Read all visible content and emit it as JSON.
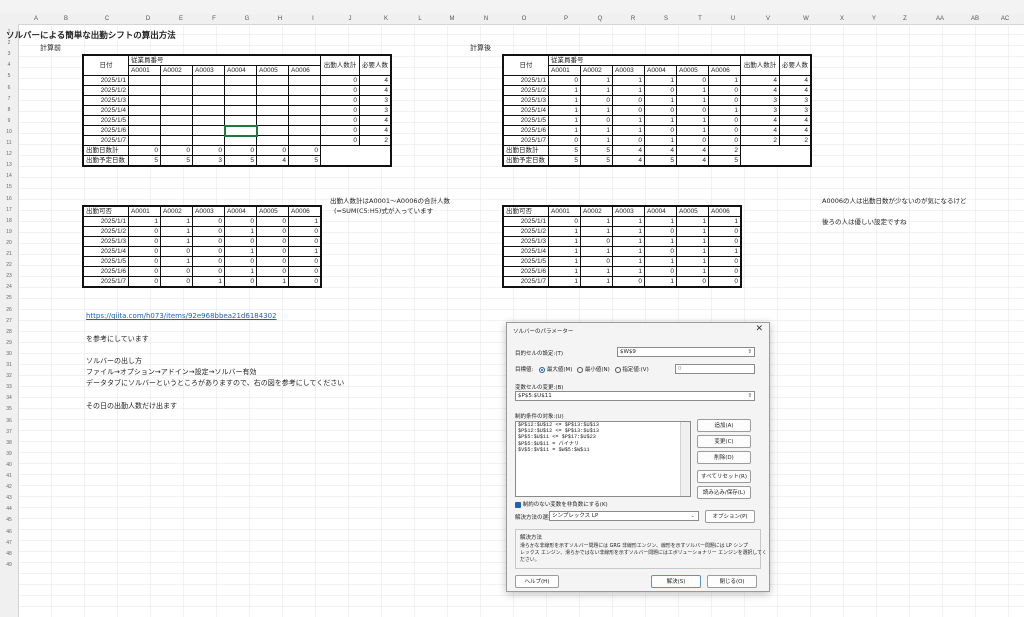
{
  "columns": [
    "A",
    "B",
    "C",
    "D",
    "E",
    "F",
    "G",
    "H",
    "I",
    "J",
    "K",
    "L",
    "M",
    "N",
    "O",
    "P",
    "Q",
    "R",
    "S",
    "T",
    "U",
    "V",
    "W",
    "X",
    "Y",
    "Z",
    "AA",
    "AB",
    "AC"
  ],
  "rows": [
    "1",
    "2",
    "3",
    "4",
    "5",
    "6",
    "7",
    "8",
    "9",
    "10",
    "11",
    "12",
    "13",
    "14",
    "15",
    "16",
    "17",
    "18",
    "19",
    "20",
    "21",
    "22",
    "23",
    "24",
    "25",
    "26",
    "27",
    "28",
    "29",
    "30",
    "31",
    "32",
    "33",
    "34",
    "35",
    "36",
    "37",
    "38",
    "39",
    "40",
    "41",
    "42",
    "43",
    "44",
    "45",
    "46",
    "47",
    "48",
    "49"
  ],
  "sheet": {
    "title": "ソルバーによる簡単な出勤シフトの算出方法",
    "before_label": "計算前",
    "after_label": "計算後",
    "sum_note_1": "出勤人数計はA0001～A0006の合計人数",
    "sum_note_2": "(=SUM(C5:H5)式が入っています",
    "comment_1": "A0006の人は出勤日数が少ないのが気になるけど",
    "comment_2": "後ろの人は優しい設定ですね",
    "link": "https://qiita.com/h073/items/92e968bbea21d6184302",
    "ref_note": "を参考にしています",
    "howto_title": "ソルバーの出し方",
    "howto_1": "ファイル→オプション→アドイン→設定→ソルバー有効",
    "howto_2": "データタブにソルバーというところがありますので、右の図を参考にしてください",
    "closing": "その日の出勤人数だけ出ます"
  },
  "shift_headers": {
    "date": "日付",
    "staff_no": "従業員番号",
    "ids": [
      "A0001",
      "A0002",
      "A0003",
      "A0004",
      "A0005",
      "A0006"
    ],
    "total": "出勤人数計",
    "required": "必要人数"
  },
  "dates": [
    "2025/1/1",
    "2025/1/2",
    "2025/1/3",
    "2025/1/4",
    "2025/1/5",
    "2025/1/6",
    "2025/1/7"
  ],
  "before": {
    "totals": [
      "0",
      "0",
      "0",
      "0",
      "0",
      "0",
      "0"
    ],
    "required": [
      "4",
      "4",
      "3",
      "3",
      "4",
      "4",
      "2"
    ],
    "days_label": "出勤日数計",
    "days": [
      "0",
      "0",
      "0",
      "0",
      "0",
      "0"
    ],
    "plan_label": "出勤予定日数",
    "plan": [
      "5",
      "5",
      "3",
      "5",
      "4",
      "5"
    ]
  },
  "after": {
    "matrix": [
      [
        "0",
        "1",
        "1",
        "1",
        "0",
        "1"
      ],
      [
        "1",
        "1",
        "1",
        "0",
        "1",
        "0"
      ],
      [
        "1",
        "0",
        "0",
        "1",
        "1",
        "0"
      ],
      [
        "1",
        "1",
        "0",
        "0",
        "0",
        "1"
      ],
      [
        "1",
        "0",
        "1",
        "1",
        "1",
        "0"
      ],
      [
        "1",
        "1",
        "1",
        "0",
        "1",
        "0"
      ],
      [
        "0",
        "1",
        "0",
        "1",
        "0",
        "0"
      ]
    ],
    "totals": [
      "4",
      "4",
      "3",
      "3",
      "4",
      "4",
      "2"
    ],
    "required": [
      "4",
      "4",
      "3",
      "3",
      "4",
      "4",
      "2"
    ],
    "days": [
      "5",
      "5",
      "4",
      "4",
      "4",
      "2"
    ],
    "plan": [
      "5",
      "5",
      "4",
      "5",
      "4",
      "5"
    ]
  },
  "avail_label": "出勤可否",
  "avail_before": [
    [
      "1",
      "1",
      "0",
      "0",
      "0",
      "1"
    ],
    [
      "0",
      "1",
      "0",
      "1",
      "0",
      "0"
    ],
    [
      "0",
      "1",
      "0",
      "0",
      "0",
      "0"
    ],
    [
      "0",
      "0",
      "0",
      "1",
      "0",
      "1"
    ],
    [
      "0",
      "1",
      "0",
      "0",
      "0",
      "0"
    ],
    [
      "0",
      "0",
      "0",
      "1",
      "0",
      "0"
    ],
    [
      "0",
      "0",
      "1",
      "0",
      "1",
      "0"
    ]
  ],
  "avail_after": [
    [
      "0",
      "1",
      "1",
      "1",
      "1",
      "1"
    ],
    [
      "1",
      "1",
      "1",
      "0",
      "1",
      "0"
    ],
    [
      "1",
      "0",
      "1",
      "1",
      "1",
      "0"
    ],
    [
      "1",
      "1",
      "1",
      "0",
      "1",
      "1"
    ],
    [
      "1",
      "0",
      "1",
      "1",
      "1",
      "0"
    ],
    [
      "1",
      "1",
      "1",
      "0",
      "1",
      "0"
    ],
    [
      "1",
      "1",
      "0",
      "1",
      "0",
      "0"
    ]
  ],
  "dialog": {
    "title": "ソルバーのパラメーター",
    "objective_label": "目的セルの設定:(T)",
    "objective_value": "$W$9",
    "target_label": "目標値:",
    "opt_max": "最大値(M)",
    "opt_min": "最小値(N)",
    "opt_value": "指定値:(V)",
    "opt_value_input": "0",
    "change_label": "変数セルの変更:(B)",
    "change_value": "$P$5:$U$11",
    "constraints_label": "制約条件の対象:(U)",
    "constraints": [
      "$P$12:$U$12 <= $P$13:$U$13",
      "$P$12:$U$12 <= $P$13:$U$13",
      "$P$5:$U$11 <= $P$17:$U$23",
      "$P$5:$U$11 = バイナリ",
      "$V$5:$V$11 = $W$5:$W$11"
    ],
    "btn_add": "追加(A)",
    "btn_change": "変更(C)",
    "btn_delete": "削除(D)",
    "btn_reset": "すべてリセット(R)",
    "btn_load": "読み込み/保存(L)",
    "nonneg_label": "制約のない変数を非負数にする(K)",
    "method_label": "解決方法の選択:(E)",
    "method_value": "シンプレックス LP",
    "btn_options": "オプション(P)",
    "method_group": "解決方法",
    "method_desc_1": "滑らかな非線形を示すソルバー問題には GRG 非線形エンジン、線形を示すソルバー問題には LP シンプ",
    "method_desc_2": "レックス エンジン、滑らかではない非線形を示すソルバー問題にはエボリューショナリー エンジンを選択してく",
    "method_desc_3": "ださい。",
    "btn_help": "ヘルプ(H)",
    "btn_solve": "解決(S)",
    "btn_close": "閉じる(O)"
  }
}
